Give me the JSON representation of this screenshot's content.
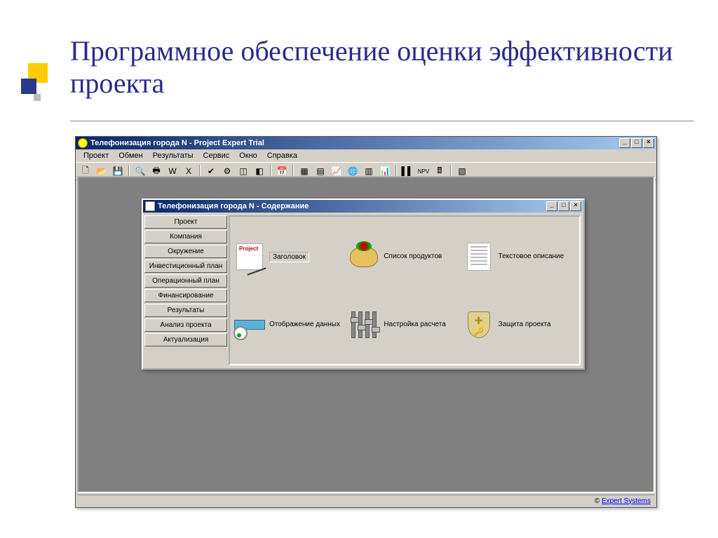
{
  "slide": {
    "title": "Программное обеспечение оценки эффективности проекта"
  },
  "app": {
    "title": "Телефонизация города N - Project Expert Trial",
    "menu": [
      "Проект",
      "Обмен",
      "Результаты",
      "Сервис",
      "Окно",
      "Справка"
    ],
    "status_link": "Expert Systems"
  },
  "child": {
    "title": "Телефонизация города N - Содержание",
    "tabs": [
      "Проект",
      "Компания",
      "Окружение",
      "Инвестиционный план",
      "Операционный план",
      "Финансирование",
      "Результаты",
      "Анализ проекта",
      "Актуализация"
    ],
    "items": {
      "header": {
        "label": "Заголовок"
      },
      "products": {
        "label": "Список продуктов"
      },
      "textdesc": {
        "label": "Текстовое описание"
      },
      "display": {
        "label": "Отображение данных"
      },
      "calcsetup": {
        "label": "Настройка расчета"
      },
      "protect": {
        "label": "Защита проекта"
      }
    }
  }
}
